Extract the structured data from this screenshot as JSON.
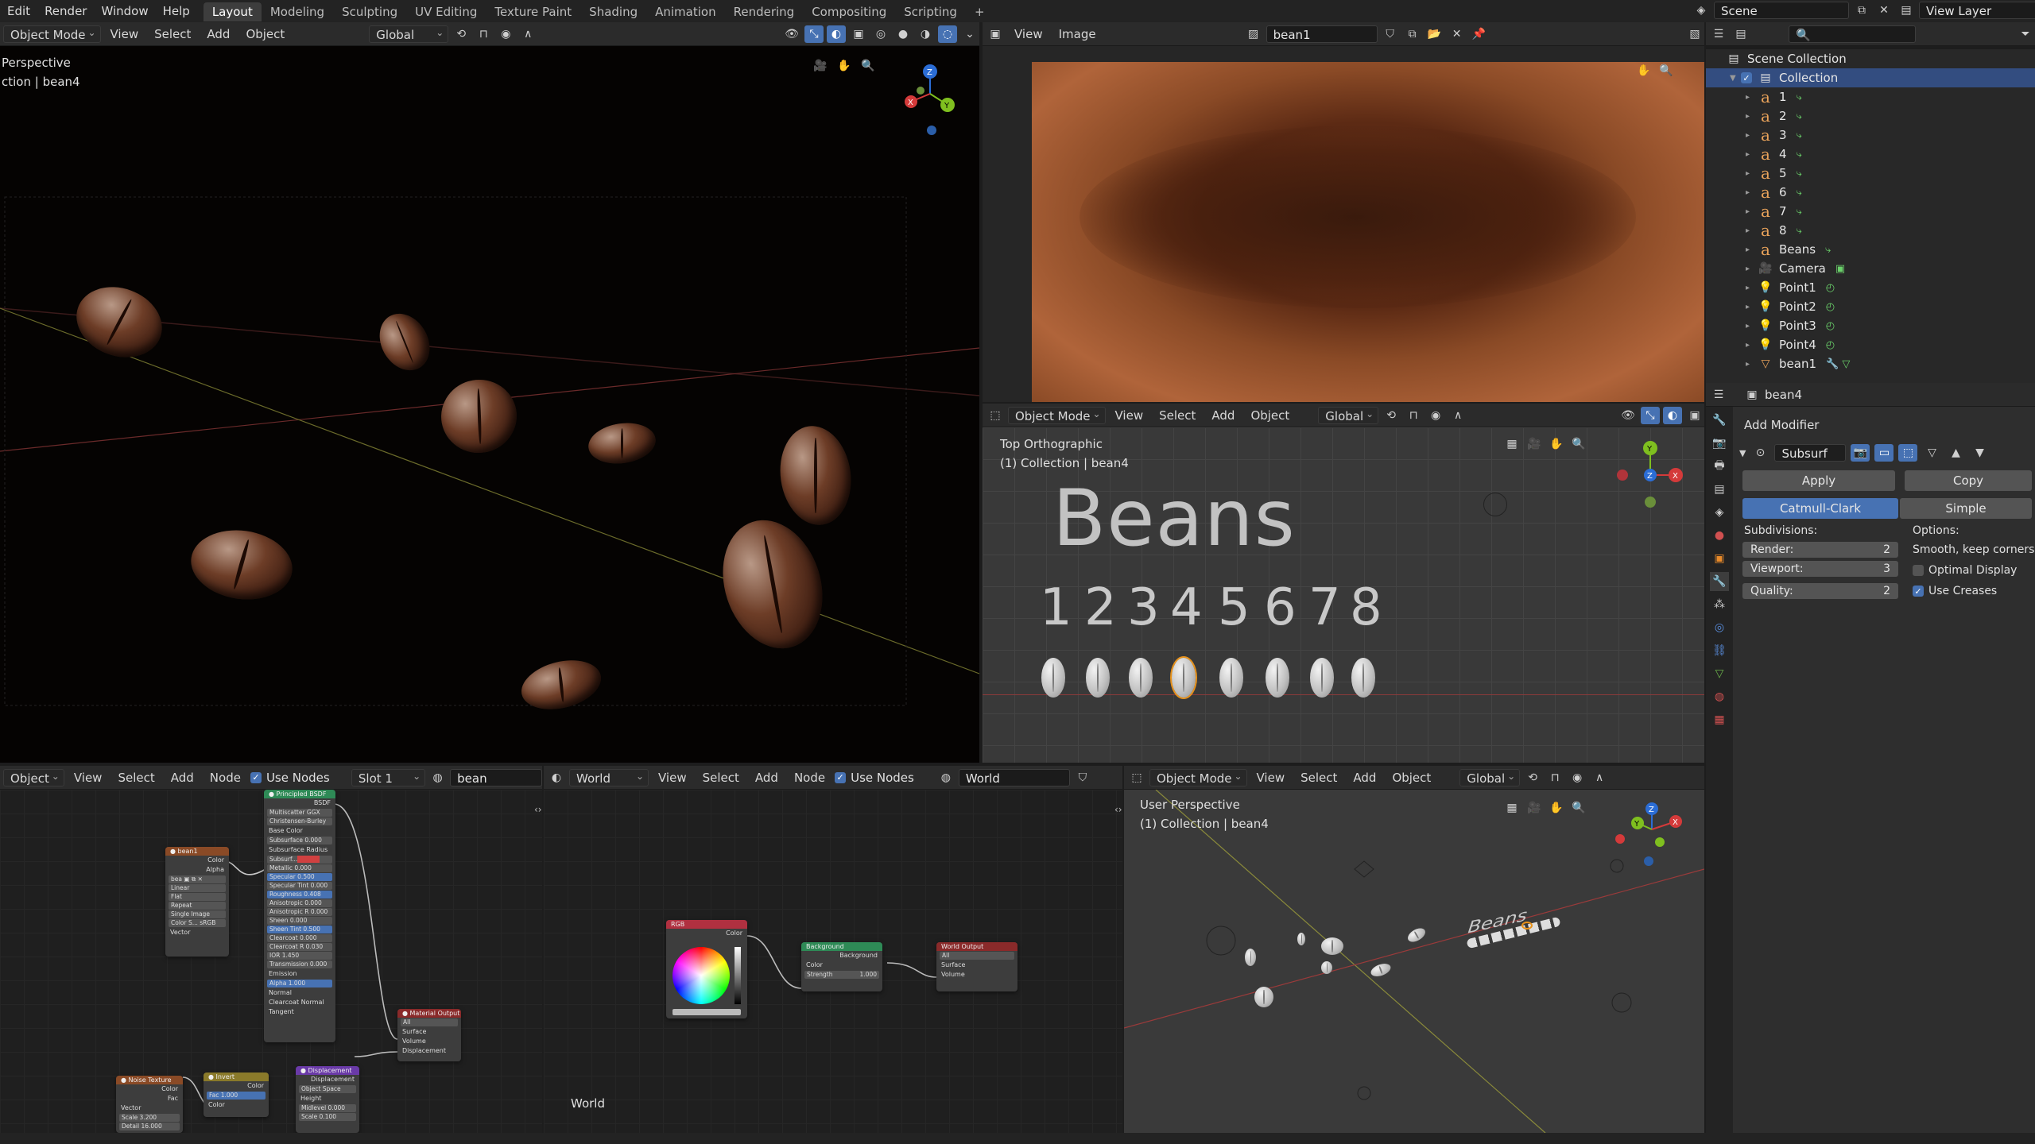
{
  "topbar": {
    "menus": [
      "Edit",
      "Render",
      "Window",
      "Help"
    ],
    "workspaces": [
      {
        "label": "Layout",
        "active": true
      },
      {
        "label": "Modeling",
        "active": false
      },
      {
        "label": "Sculpting",
        "active": false
      },
      {
        "label": "UV Editing",
        "active": false
      },
      {
        "label": "Texture Paint",
        "active": false
      },
      {
        "label": "Shading",
        "active": false
      },
      {
        "label": "Animation",
        "active": false
      },
      {
        "label": "Rendering",
        "active": false
      },
      {
        "label": "Compositing",
        "active": false
      },
      {
        "label": "Scripting",
        "active": false
      }
    ],
    "add_tab": "+",
    "scene": "Scene",
    "view_layer": "View Layer"
  },
  "viewport_main": {
    "mode": "Object Mode",
    "menus": [
      "View",
      "Select",
      "Add",
      "Object"
    ],
    "orientation": "Global",
    "overlay_line1": "Perspective",
    "overlay_line2": "ction | bean4"
  },
  "image_editor": {
    "menus": [
      "View",
      "Image"
    ],
    "image_name": "bean1"
  },
  "viewport_top": {
    "mode": "Object Mode",
    "menus": [
      "View",
      "Select",
      "Add",
      "Object"
    ],
    "orientation": "Global",
    "overlay_line1": "Top Orthographic",
    "overlay_line2": "(1) Collection | bean4",
    "title_text": "Beans",
    "numbers": [
      "1",
      "2",
      "3",
      "4",
      "5",
      "6",
      "7",
      "8"
    ]
  },
  "viewport_user": {
    "mode": "Object Mode",
    "menus": [
      "View",
      "Select",
      "Add",
      "Object"
    ],
    "orientation": "Global",
    "overlay_line1": "User Perspective",
    "overlay_line2": "(1) Collection | bean4"
  },
  "shader_editor": {
    "object_menu": "Object",
    "menus": [
      "View",
      "Select",
      "Add",
      "Node"
    ],
    "use_nodes": "Use Nodes",
    "slot": "Slot 1",
    "material": "bean"
  },
  "world_editor": {
    "type": "World",
    "menus": [
      "View",
      "Select",
      "Add",
      "Node"
    ],
    "use_nodes": "Use Nodes",
    "world_name": "World",
    "footer_label": "World",
    "rgb_node": {
      "title": "RGB",
      "out": "Color"
    },
    "background_node": {
      "title": "Background",
      "out": "Background",
      "in1": "Color",
      "strength_label": "Strength",
      "strength_value": "1.000"
    },
    "world_output_node": {
      "title": "World Output",
      "target": "All",
      "in1": "Surface",
      "in2": "Volume"
    }
  },
  "outliner": {
    "search_placeholder": "",
    "items": [
      {
        "label": "Scene Collection",
        "level": 0,
        "icon": "collection-icon",
        "type": "root"
      },
      {
        "label": "Collection",
        "level": 1,
        "icon": "collection-icon",
        "selected": true
      },
      {
        "label": "1",
        "level": 2,
        "icon": "text-object-icon"
      },
      {
        "label": "2",
        "level": 2,
        "icon": "text-object-icon"
      },
      {
        "label": "3",
        "level": 2,
        "icon": "text-object-icon"
      },
      {
        "label": "4",
        "level": 2,
        "icon": "text-object-icon"
      },
      {
        "label": "5",
        "level": 2,
        "icon": "text-object-icon"
      },
      {
        "label": "6",
        "level": 2,
        "icon": "text-object-icon"
      },
      {
        "label": "7",
        "level": 2,
        "icon": "text-object-icon"
      },
      {
        "label": "8",
        "level": 2,
        "icon": "text-object-icon"
      },
      {
        "label": "Beans",
        "level": 2,
        "icon": "text-object-icon"
      },
      {
        "label": "Camera",
        "level": 2,
        "icon": "camera-icon"
      },
      {
        "label": "Point1",
        "level": 2,
        "icon": "light-icon"
      },
      {
        "label": "Point2",
        "level": 2,
        "icon": "light-icon"
      },
      {
        "label": "Point3",
        "level": 2,
        "icon": "light-icon"
      },
      {
        "label": "Point4",
        "level": 2,
        "icon": "light-icon"
      },
      {
        "label": "bean1",
        "level": 2,
        "icon": "mesh-icon"
      }
    ]
  },
  "properties": {
    "object_name": "bean4",
    "add_modifier": "Add Modifier",
    "modifier_name": "Subsurf",
    "apply": "Apply",
    "copy": "Copy",
    "algo_a": "Catmull-Clark",
    "algo_b": "Simple",
    "subdivisions_label": "Subdivisions:",
    "options_label": "Options:",
    "render_label": "Render:",
    "render_value": "2",
    "viewport_label": "Viewport:",
    "viewport_value": "3",
    "quality_label": "Quality:",
    "quality_value": "2",
    "uv_smooth": "Smooth, keep corners",
    "optimal_display": "Optimal Display",
    "optimal_display_checked": false,
    "use_creases": "Use Creases",
    "use_creases_checked": true
  },
  "colors": {
    "accent": "#4772b3",
    "outliner_selected": "#334d80",
    "header_bg": "#2b2b2b",
    "bean_selected": "#e8921a"
  }
}
